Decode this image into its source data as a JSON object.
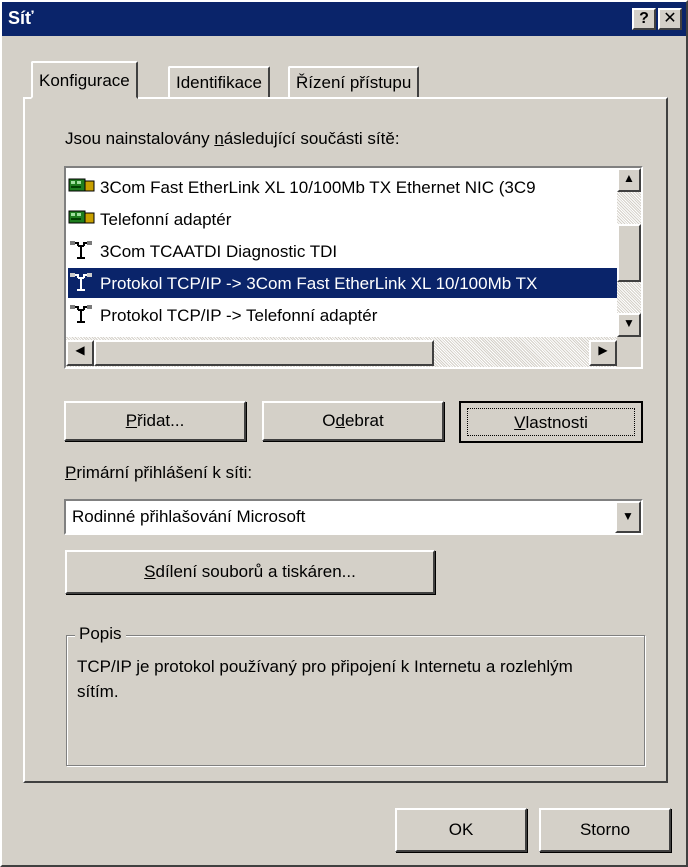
{
  "window": {
    "title": "Síť",
    "help_glyph": "?",
    "close_glyph": "✕"
  },
  "tabs": [
    {
      "label": "Konfigurace",
      "active": true
    },
    {
      "label": "Identifikace",
      "active": false
    },
    {
      "label": "Řízení přístupu",
      "active": false
    }
  ],
  "components": {
    "label_pre": "Jsou nainstalovány ",
    "label_hotkey": "n",
    "label_post": "ásledující součásti sítě:",
    "items": [
      {
        "label": "3Com Fast EtherLink XL 10/100Mb TX Ethernet NIC (3C9",
        "icon": "network-adapter-icon",
        "selected": false
      },
      {
        "label": "Telefonní adaptér",
        "icon": "network-adapter-icon",
        "selected": false
      },
      {
        "label": "3Com TCAATDI Diagnostic TDI",
        "icon": "protocol-icon",
        "selected": false
      },
      {
        "label": "Protokol TCP/IP -> 3Com Fast EtherLink XL 10/100Mb TX",
        "icon": "protocol-icon",
        "selected": true
      },
      {
        "label": "Protokol TCP/IP -> Telefonní adaptér",
        "icon": "protocol-icon",
        "selected": false
      }
    ]
  },
  "buttons": {
    "add_hotkey": "P",
    "add_rest": "řidat...",
    "remove_pre": "O",
    "remove_hotkey": "d",
    "remove_rest": "ebrat",
    "properties_hotkey": "V",
    "properties_rest": "lastnosti"
  },
  "primary_logon": {
    "label_hotkey": "P",
    "label_rest": "rimární přihlášení k síti:",
    "value": "Rodinné přihlašování Microsoft"
  },
  "sharing_button": {
    "hotkey": "S",
    "rest": "dílení souborů a tiskáren..."
  },
  "description": {
    "legend": "Popis",
    "text": "TCP/IP je protokol používaný pro připojení k Internetu a rozlehlým sítím."
  },
  "dialog_buttons": {
    "ok": "OK",
    "cancel": "Storno"
  },
  "colors": {
    "selection": "#0a246a",
    "face": "#d4d0c8"
  }
}
